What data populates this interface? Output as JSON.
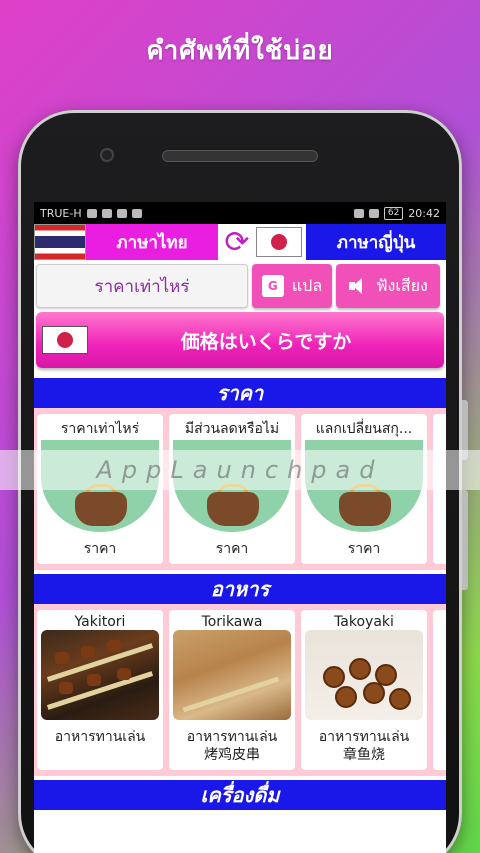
{
  "banner": {
    "title": "คำศัพท์ที่ใช้บ่อย"
  },
  "statusbar": {
    "carrier": "TRUE-H",
    "battery": "62",
    "time": "20:42"
  },
  "langbar": {
    "source_lang": "ภาษาไทย",
    "target_lang": "ภาษาญี่ปุ่น",
    "swap_icon": "refresh-icon"
  },
  "inputrow": {
    "input_value": "ราคาเท่าไหร่",
    "translate_label": "แปล",
    "listen_label": "ฟังเสียง"
  },
  "result": {
    "text": "価格はいくらですか"
  },
  "sections": [
    {
      "title": "ราคา",
      "cards": [
        {
          "title": "ราคาเท่าไหร่",
          "foot": "ราคา"
        },
        {
          "title": "มีส่วนลดหรือไม่",
          "foot": "ราคา"
        },
        {
          "title": "แลกเปลี่ยนสกุ...",
          "foot": "ราคา"
        }
      ]
    },
    {
      "title": "อาหาร",
      "cards": [
        {
          "title": "Yakitori",
          "foot": "อาหารทานเล่น",
          "foot2": ""
        },
        {
          "title": "Torikawa",
          "foot": "อาหารทานเล่น",
          "foot2": "烤鸡皮串"
        },
        {
          "title": "Takoyaki",
          "foot": "อาหารทานเล่น",
          "foot2": "章鱼烧"
        }
      ]
    },
    {
      "title": "เครื่องดื่ม"
    }
  ],
  "watermark": "AppLaunchpad"
}
